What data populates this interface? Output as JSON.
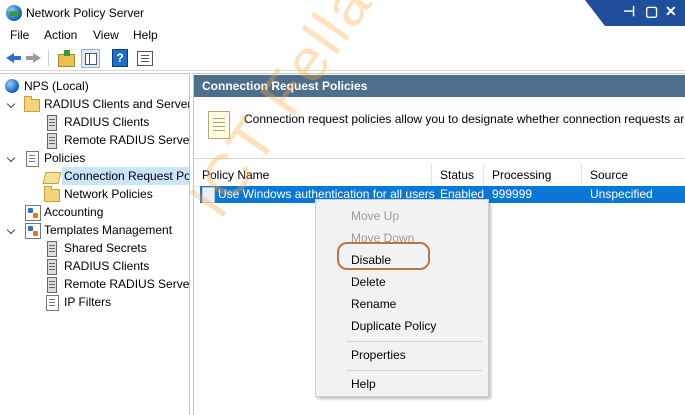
{
  "window": {
    "title": "Network Policy Server"
  },
  "menu": [
    "File",
    "Action",
    "View",
    "Help"
  ],
  "toolbar": {
    "icons": [
      "back-arrow-icon",
      "forward-arrow-icon",
      "up-folder-icon",
      "show-hide-tree-icon",
      "help-icon",
      "properties-icon"
    ]
  },
  "tree": {
    "root": "NPS (Local)",
    "radius_group": "RADIUS Clients and Servers",
    "radius_clients": "RADIUS Clients",
    "remote_servers": "Remote RADIUS Server G",
    "policies": "Policies",
    "connection_request": "Connection Request Poli",
    "network_policies": "Network Policies",
    "accounting": "Accounting",
    "templates": "Templates Management",
    "shared_secrets": "Shared Secrets",
    "t_radius_clients": "RADIUS Clients",
    "t_remote_servers": "Remote RADIUS Servers",
    "ip_filters": "IP Filters"
  },
  "main": {
    "section_title": "Connection Request Policies",
    "description": "Connection request policies allow you to designate whether connection requests are processe",
    "columns": [
      "Policy Name",
      "Status",
      "Processing Order",
      "Source"
    ],
    "rows": [
      {
        "name": "Use Windows authentication for all users",
        "status": "Enabled",
        "order": "999999",
        "source": "Unspecified"
      }
    ]
  },
  "context_menu": {
    "move_up": "Move Up",
    "move_down": "Move Down",
    "disable": "Disable",
    "delete": "Delete",
    "rename": "Rename",
    "duplicate": "Duplicate Policy",
    "properties": "Properties",
    "help": "Help"
  },
  "watermark": "ICT Fella",
  "colors": {
    "section_header": "#4e6e8e",
    "selection": "#0a78d7",
    "highlight_ring": "#b97546"
  }
}
